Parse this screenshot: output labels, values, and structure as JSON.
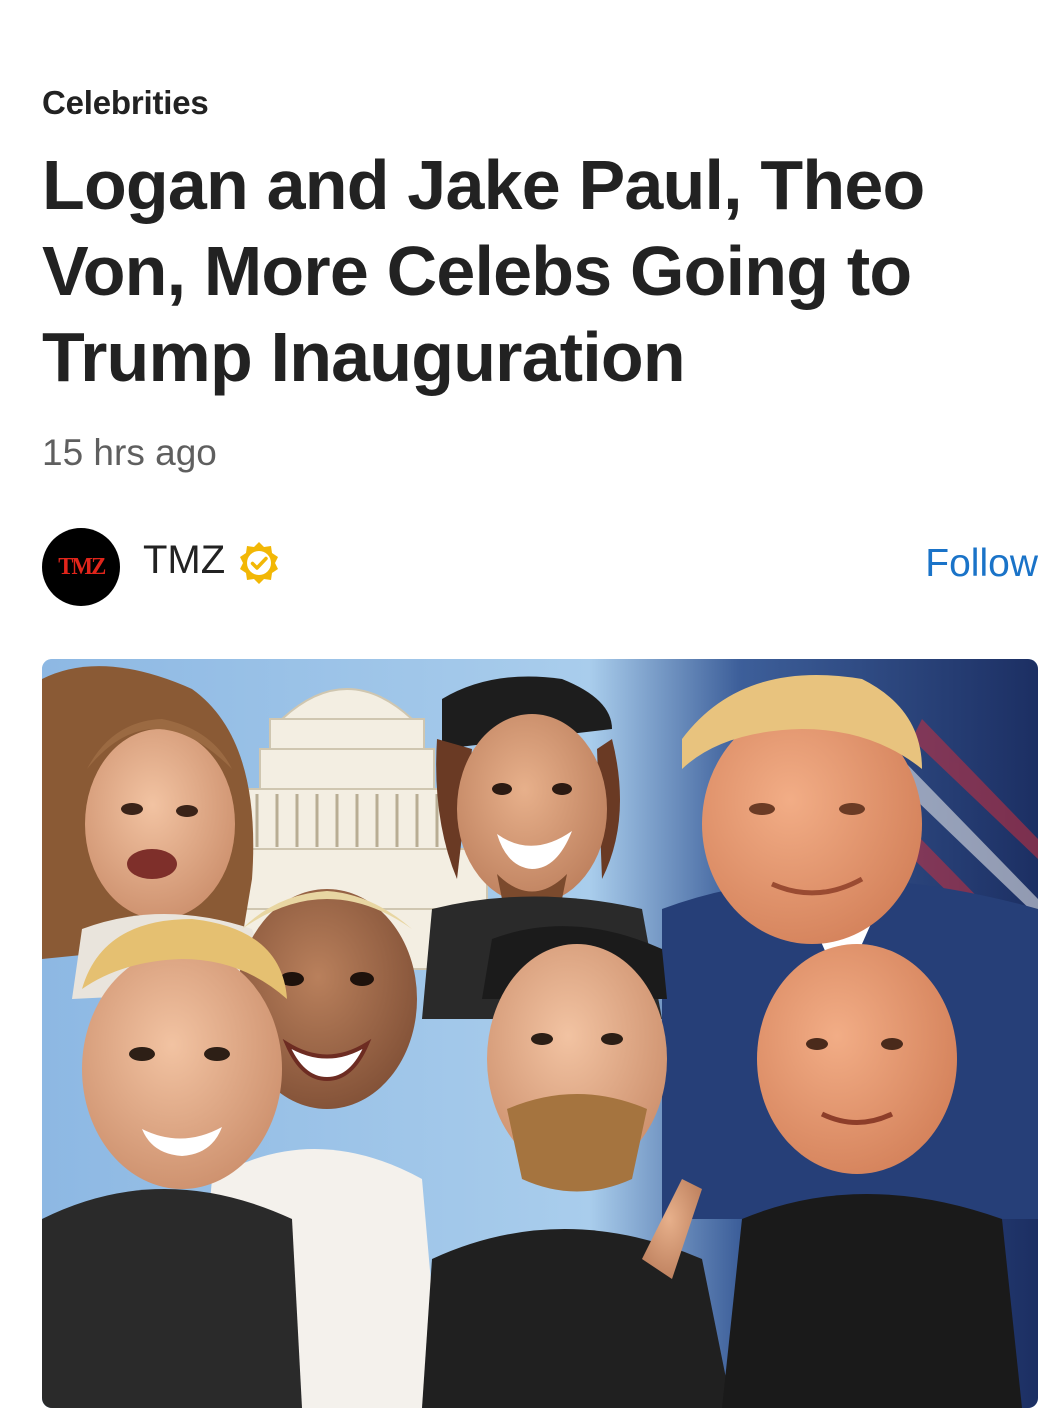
{
  "article": {
    "category": "Celebrities",
    "headline": "Logan and Jake Paul, Theo Von, More Celebs Going to Trump Inauguration",
    "timestamp": "15 hrs ago"
  },
  "publisher": {
    "logo_text": "TMZ",
    "name": "TMZ",
    "verified_icon": "verified-badge-icon",
    "follow_label": "Follow"
  },
  "colors": {
    "follow": "#1a73c8",
    "verified": "#f2b705",
    "logo_text": "#e1251b"
  },
  "hero_image": {
    "icon": "collage-photo"
  }
}
